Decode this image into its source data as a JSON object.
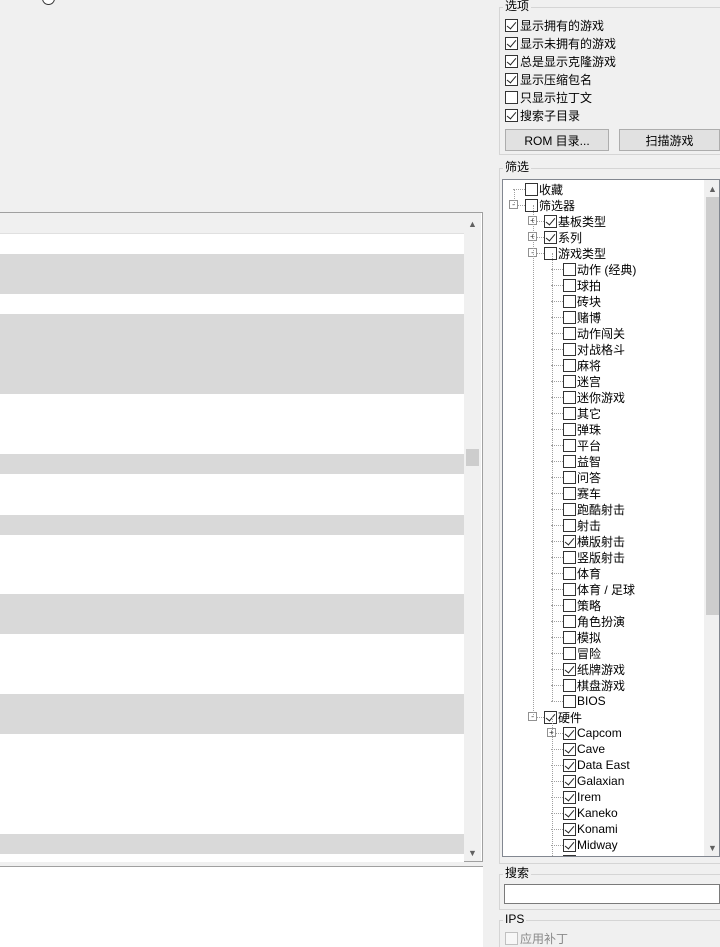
{
  "options": {
    "title": "选项",
    "items": [
      {
        "label": "显示拥有的游戏",
        "checked": true
      },
      {
        "label": "显示未拥有的游戏",
        "checked": true
      },
      {
        "label": "总是显示克隆游戏",
        "checked": true
      },
      {
        "label": "显示压缩包名",
        "checked": true
      },
      {
        "label": "只显示拉丁文",
        "checked": false
      },
      {
        "label": "搜索子目录",
        "checked": true
      }
    ],
    "rom_dir_button": "ROM 目录...",
    "scan_button": "扫描游戏"
  },
  "filter": {
    "title": "筛选",
    "tree": [
      {
        "label": "收藏",
        "checked": false,
        "level": 0,
        "expander": ""
      },
      {
        "label": "筛选器",
        "checked": false,
        "level": 0,
        "expander": "-"
      },
      {
        "label": "基板类型",
        "checked": true,
        "level": 1,
        "expander": "+"
      },
      {
        "label": "系列",
        "checked": true,
        "level": 1,
        "expander": "+"
      },
      {
        "label": "游戏类型",
        "checked": false,
        "level": 1,
        "expander": "-"
      },
      {
        "label": "动作 (经典)",
        "checked": false,
        "level": 2,
        "expander": ""
      },
      {
        "label": "球拍",
        "checked": false,
        "level": 2,
        "expander": ""
      },
      {
        "label": "砖块",
        "checked": false,
        "level": 2,
        "expander": ""
      },
      {
        "label": "赌博",
        "checked": false,
        "level": 2,
        "expander": ""
      },
      {
        "label": "动作闯关",
        "checked": false,
        "level": 2,
        "expander": ""
      },
      {
        "label": "对战格斗",
        "checked": false,
        "level": 2,
        "expander": ""
      },
      {
        "label": "麻将",
        "checked": false,
        "level": 2,
        "expander": ""
      },
      {
        "label": "迷宫",
        "checked": false,
        "level": 2,
        "expander": ""
      },
      {
        "label": "迷你游戏",
        "checked": false,
        "level": 2,
        "expander": ""
      },
      {
        "label": "其它",
        "checked": false,
        "level": 2,
        "expander": ""
      },
      {
        "label": "弹珠",
        "checked": false,
        "level": 2,
        "expander": ""
      },
      {
        "label": "平台",
        "checked": false,
        "level": 2,
        "expander": ""
      },
      {
        "label": "益智",
        "checked": false,
        "level": 2,
        "expander": ""
      },
      {
        "label": "问答",
        "checked": false,
        "level": 2,
        "expander": ""
      },
      {
        "label": "赛车",
        "checked": false,
        "level": 2,
        "expander": ""
      },
      {
        "label": "跑酷射击",
        "checked": false,
        "level": 2,
        "expander": ""
      },
      {
        "label": "射击",
        "checked": false,
        "level": 2,
        "expander": ""
      },
      {
        "label": "横版射击",
        "checked": true,
        "level": 2,
        "expander": ""
      },
      {
        "label": "竖版射击",
        "checked": false,
        "level": 2,
        "expander": ""
      },
      {
        "label": "体育",
        "checked": false,
        "level": 2,
        "expander": ""
      },
      {
        "label": "体育 / 足球",
        "checked": false,
        "level": 2,
        "expander": ""
      },
      {
        "label": "策略",
        "checked": false,
        "level": 2,
        "expander": ""
      },
      {
        "label": "角色扮演",
        "checked": false,
        "level": 2,
        "expander": ""
      },
      {
        "label": "模拟",
        "checked": false,
        "level": 2,
        "expander": ""
      },
      {
        "label": "冒险",
        "checked": false,
        "level": 2,
        "expander": ""
      },
      {
        "label": "纸牌游戏",
        "checked": true,
        "level": 2,
        "expander": ""
      },
      {
        "label": "棋盘游戏",
        "checked": false,
        "level": 2,
        "expander": ""
      },
      {
        "label": "BIOS",
        "checked": false,
        "level": 2,
        "expander": ""
      },
      {
        "label": "硬件",
        "checked": true,
        "level": 1,
        "expander": "-"
      },
      {
        "label": "Capcom",
        "checked": true,
        "level": 2,
        "expander": "+"
      },
      {
        "label": "Cave",
        "checked": true,
        "level": 2,
        "expander": ""
      },
      {
        "label": "Data East",
        "checked": true,
        "level": 2,
        "expander": ""
      },
      {
        "label": "Galaxian",
        "checked": true,
        "level": 2,
        "expander": ""
      },
      {
        "label": "Irem",
        "checked": true,
        "level": 2,
        "expander": ""
      },
      {
        "label": "Kaneko",
        "checked": true,
        "level": 2,
        "expander": ""
      },
      {
        "label": "Konami",
        "checked": true,
        "level": 2,
        "expander": ""
      },
      {
        "label": "Midway",
        "checked": true,
        "level": 2,
        "expander": ""
      },
      {
        "label": "NeoGeo",
        "checked": true,
        "level": 2,
        "expander": ""
      }
    ]
  },
  "search": {
    "title": "搜索",
    "value": ""
  },
  "ips": {
    "title": "IPS",
    "apply_patch_label": "应用补丁",
    "apply_patch_checked": false
  },
  "colors": {
    "band": "#d9d9d9",
    "panel": "#f0f0f0",
    "border": "#a0a0a0"
  }
}
